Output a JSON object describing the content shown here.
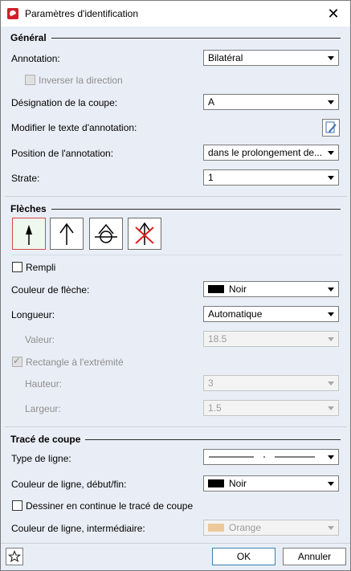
{
  "dialog": {
    "title": "Paramètres d'identification",
    "close_glyph": "✕"
  },
  "general": {
    "heading": "Général",
    "annotation_label": "Annotation:",
    "annotation_value": "Bilatéral",
    "invert_label": "Inverser la direction",
    "designation_label": "Désignation de la coupe:",
    "designation_value": "A",
    "modify_text_label": "Modifier le texte d'annotation:",
    "position_label": "Position de l'annotation:",
    "position_value": "dans le prolongement de...",
    "layer_label": "Strate:",
    "layer_value": "1"
  },
  "arrows": {
    "heading": "Flèches",
    "filled_label": "Rempli",
    "color_label": "Couleur de flèche:",
    "color_value": "Noir",
    "color_hex": "#000000",
    "length_label": "Longueur:",
    "length_value": "Automatique",
    "value_label": "Valeur:",
    "value_value": "18.5",
    "rect_label": "Rectangle à l'extrémité",
    "height_label": "Hauteur:",
    "height_value": "3",
    "width_label": "Largeur:",
    "width_value": "1.5"
  },
  "cut_line": {
    "heading": "Tracé de coupe",
    "line_type_label": "Type de ligne:",
    "color_ends_label": "Couleur de ligne, début/fin:",
    "color_ends_value": "Noir",
    "color_ends_hex": "#000000",
    "continuous_label": "Dessiner en continue le tracé de coupe",
    "color_mid_label": "Couleur de ligne, intermédiaire:",
    "color_mid_value": "Orange",
    "color_mid_hex": "#ecc99a"
  },
  "footer": {
    "ok_label": "OK",
    "cancel_label": "Annuler"
  },
  "colors": {
    "dialog_bg": "#e9eef6",
    "selected_border": "#d24a4a",
    "arrow_red": "#e02020"
  }
}
